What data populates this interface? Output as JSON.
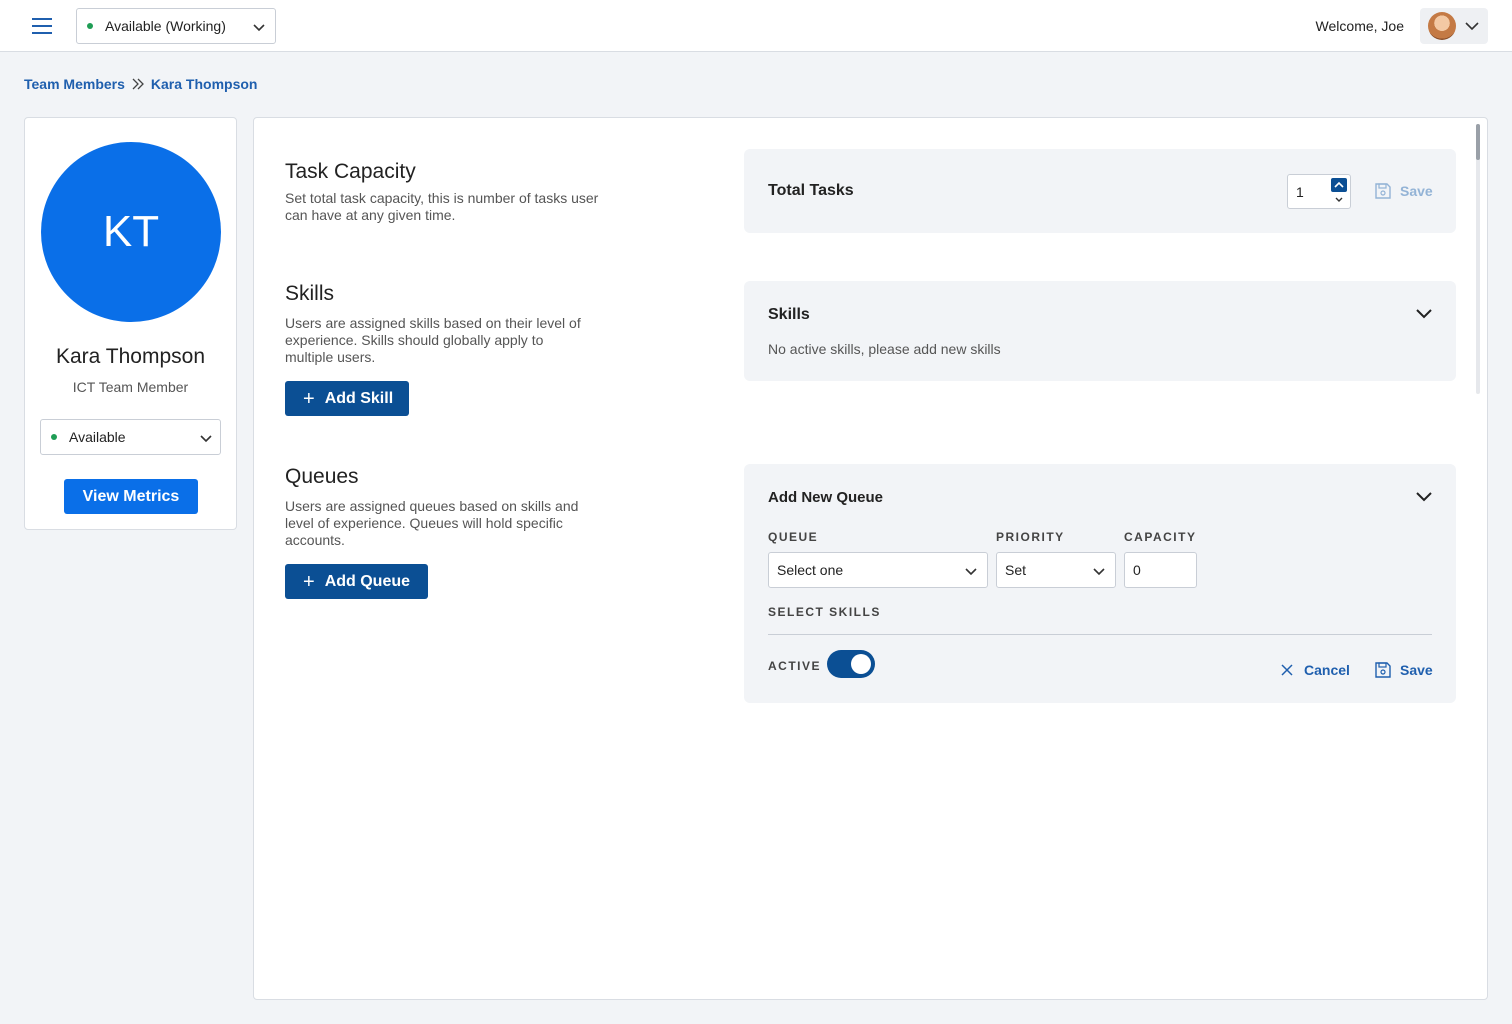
{
  "header": {
    "status": "Available (Working)",
    "welcome": "Welcome, Joe"
  },
  "breadcrumb": {
    "parent": "Team Members",
    "current": "Kara Thompson"
  },
  "profile": {
    "initials": "KT",
    "name": "Kara Thompson",
    "role": "ICT Team Member",
    "status": "Available",
    "metrics_button": "View Metrics"
  },
  "task_capacity": {
    "title": "Task Capacity",
    "description": "Set total task capacity, this is number of tasks user can have at any given time.",
    "panel_title": "Total Tasks",
    "value": "1",
    "save_label": "Save"
  },
  "skills": {
    "title": "Skills",
    "description": "Users are assigned skills based on their level of experience. Skills should globally apply to multiple users.",
    "add_button": "Add Skill",
    "panel_title": "Skills",
    "empty_message": "No active skills, please add new skills"
  },
  "queues": {
    "title": "Queues",
    "description": "Users are assigned queues based on skills and level of experience. Queues will hold specific accounts.",
    "add_button": "Add Queue",
    "panel_title": "Add New Queue",
    "queue_label": "QUEUE",
    "queue_value": "Select one",
    "priority_label": "PRIORITY",
    "priority_value": "Set",
    "capacity_label": "CAPACITY",
    "capacity_value": "0",
    "select_skills_label": "SELECT SKILLS",
    "active_label": "ACTIVE",
    "active": true,
    "cancel_label": "Cancel",
    "save_label": "Save"
  },
  "colors": {
    "primary": "#0b4f94",
    "avatar": "#0a6fe8",
    "status_dot": "#1f9d55",
    "link": "#1f5fae"
  }
}
